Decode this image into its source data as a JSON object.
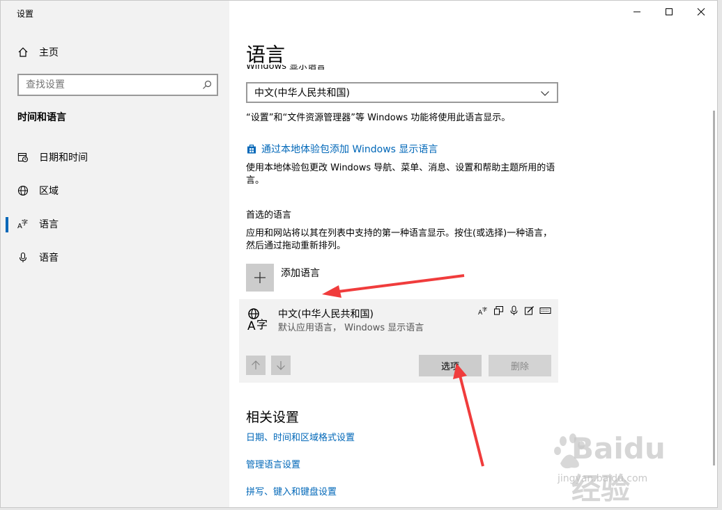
{
  "window": {
    "title": "设置",
    "controls": {
      "minimize": "—",
      "maximize": "☐",
      "close": "✕"
    }
  },
  "sidebar": {
    "home_label": "主页",
    "search_placeholder": "查找设置",
    "section_title": "时间和语言",
    "items": [
      {
        "label": "日期和时间",
        "icon": "calendar-clock-icon",
        "active": false
      },
      {
        "label": "区域",
        "icon": "globe-icon",
        "active": false
      },
      {
        "label": "语言",
        "icon": "language-icon",
        "active": true
      },
      {
        "label": "语音",
        "icon": "microphone-icon",
        "active": false
      }
    ]
  },
  "main": {
    "title": "语言",
    "display_language_label": "Windows 显示语言",
    "display_language_value": "中文(中华人民共和国)",
    "display_language_desc": "“设置”和“文件资源管理器”等 Windows 功能将使用此语言显示。",
    "add_display_lang_link": "通过本地体验包添加 Windows 显示语言",
    "local_exp_desc": "使用本地体验包更改 Windows 导航、菜单、消息、设置和帮助主题所用的语言。",
    "preferred_heading": "首选的语言",
    "preferred_desc": "应用和网站将以其在列表中支持的第一种语言显示。按住(或选择)一种语言，然后通过拖动重新排列。",
    "add_language_label": "添加语言",
    "language_card": {
      "name": "中文(中华人民共和国)",
      "subtitle": "默认应用语言， Windows 显示语言",
      "options_label": "选项",
      "remove_label": "删除"
    },
    "related_title": "相关设置",
    "related_links": [
      "日期、时间和区域格式设置",
      "管理语言设置",
      "拼写、键入和键盘设置"
    ]
  },
  "watermark": {
    "brand": "Baidu经验",
    "url": "jingyan.baidu.com"
  },
  "colors": {
    "accent": "#0067b8",
    "annotation_arrow": "#f03c3c",
    "sidebar_bg": "#f2f2f2"
  }
}
